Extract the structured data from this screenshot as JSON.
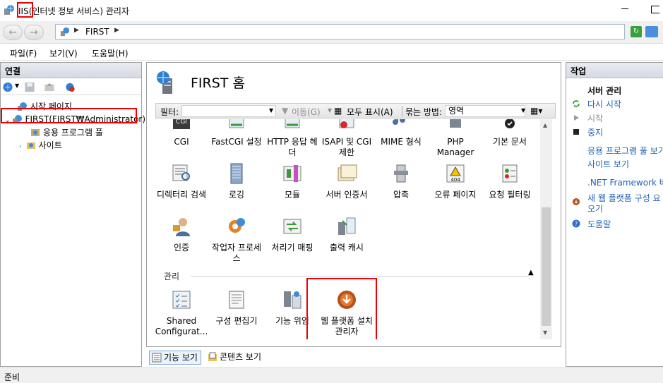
{
  "window": {
    "title": "IIS(인터넷 정보 서비스) 관리자"
  },
  "address": {
    "crumb": "FIRST"
  },
  "menu": {
    "items": [
      "파일(F)",
      "보기(V)",
      "도움말(H)"
    ]
  },
  "connections": {
    "header": "연결",
    "tree": {
      "start_page": "시작 페이지",
      "server": "FIRST(FIRST₩Administrator)",
      "app_pools": "응용 프로그램 풀",
      "sites": "사이트"
    }
  },
  "home": {
    "title": "FIRST 홈",
    "filter_label": "필터:",
    "filter_value": "",
    "go_label": "이동(G)",
    "show_all_label": "모두 표시(A)",
    "group_by_label": "묶는 방법:",
    "group_by_value": "영역"
  },
  "features": {
    "row1": [
      {
        "label": "CGI",
        "icon": "cgi-icon"
      },
      {
        "label": "FastCGI 설정",
        "icon": "fastcgi-icon"
      },
      {
        "label": "HTTP 응답 헤더",
        "icon": "http-headers-icon"
      },
      {
        "label": "ISAPI 및 CGI 제한",
        "icon": "isapi-cgi-icon"
      },
      {
        "label": "MIME 형식",
        "icon": "mime-icon"
      },
      {
        "label": "PHP Manager",
        "icon": "php-manager-icon"
      },
      {
        "label": "기본 문서",
        "icon": "default-document-icon"
      }
    ],
    "row2": [
      {
        "label": "디렉터리 검색",
        "icon": "directory-browsing-icon"
      },
      {
        "label": "로깅",
        "icon": "logging-icon"
      },
      {
        "label": "모듈",
        "icon": "modules-icon"
      },
      {
        "label": "서버 인증서",
        "icon": "server-certificates-icon"
      },
      {
        "label": "압축",
        "icon": "compression-icon"
      },
      {
        "label": "오류 페이지",
        "icon": "error-pages-icon"
      },
      {
        "label": "요청 필터링",
        "icon": "request-filtering-icon"
      }
    ],
    "row3": [
      {
        "label": "인증",
        "icon": "authentication-icon"
      },
      {
        "label": "작업자 프로세스",
        "icon": "worker-processes-icon"
      },
      {
        "label": "처리기 매핑",
        "icon": "handler-mappings-icon"
      },
      {
        "label": "출력 캐시",
        "icon": "output-caching-icon"
      }
    ],
    "management_header": "관리",
    "management": [
      {
        "label": "Shared Configurat...",
        "icon": "shared-configuration-icon"
      },
      {
        "label": "구성 편집기",
        "icon": "configuration-editor-icon"
      },
      {
        "label": "기능 위임",
        "icon": "feature-delegation-icon"
      },
      {
        "label": "웹 플랫폼 설치 관리자",
        "icon": "web-platform-installer-icon"
      }
    ],
    "error_page_code": "404"
  },
  "view_tabs": {
    "features_view": "기능 보기",
    "content_view": "콘텐츠 보기"
  },
  "actions": {
    "header": "작업",
    "server_manage": "서버 관리",
    "restart": "다시 시작",
    "start": "시작",
    "stop": "중지",
    "view_app_pools": "응용 프로그램 풀 보기",
    "view_sites": "사이트 보기",
    "net_framework": ".NET Framework 버전",
    "new_web_platform": "새 웹 플랫폼 구성 요",
    "new_web_platform_2": "오기",
    "help": "도움말"
  },
  "status": {
    "text": "준비"
  },
  "colors": {
    "highlight": "#e00000",
    "link": "#1f62b6"
  }
}
